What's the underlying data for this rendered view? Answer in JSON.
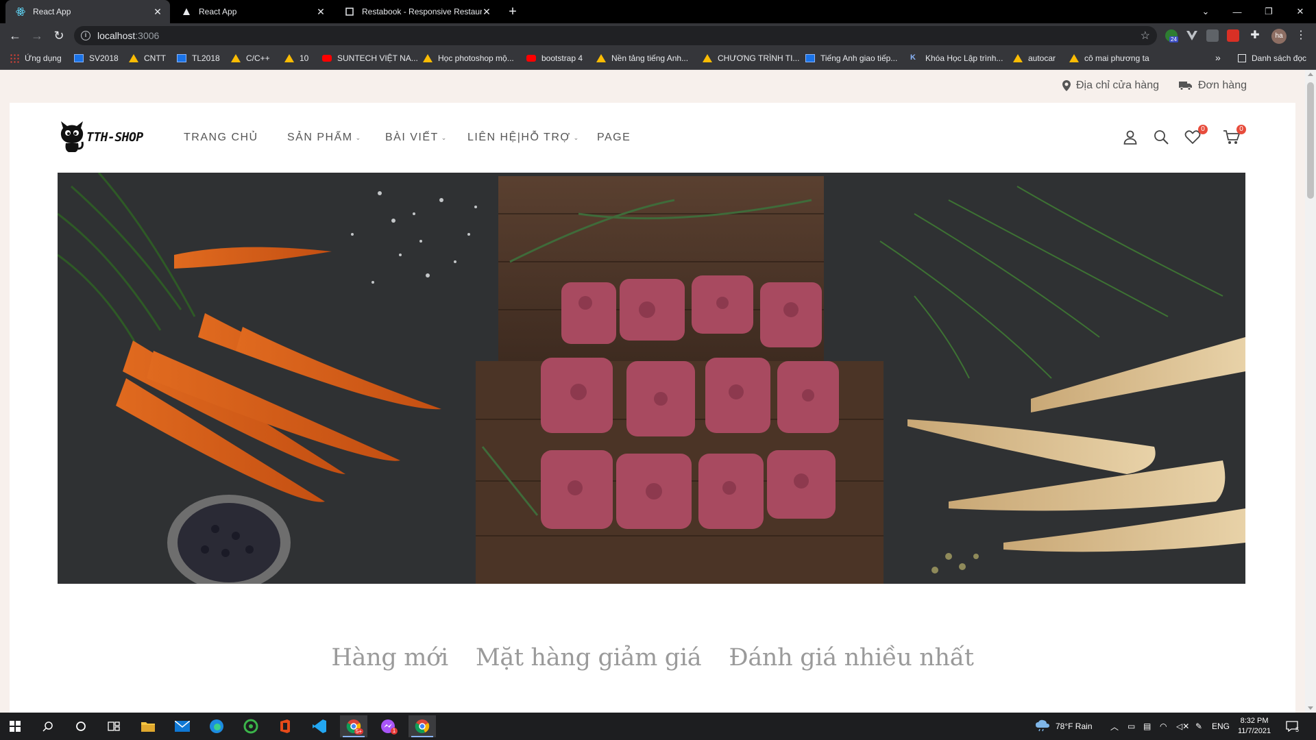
{
  "browser": {
    "tabs": [
      {
        "title": "React App",
        "active": true,
        "icon": "react-icon"
      },
      {
        "title": "React App",
        "active": false,
        "icon": "triangle-icon"
      },
      {
        "title": "Restabook - Responsive Restaura",
        "active": false,
        "icon": "page-icon"
      }
    ],
    "url_host": "localhost",
    "url_port": ":3006",
    "extension_badge": "24",
    "profile_initials": "ha",
    "bookmarks": [
      {
        "label": "Ứng dụng",
        "icon": "apps-grid-icon"
      },
      {
        "label": "SV2018",
        "icon": "monitor-icon"
      },
      {
        "label": "CNTT",
        "icon": "drive-icon"
      },
      {
        "label": "TL2018",
        "icon": "monitor-icon"
      },
      {
        "label": "C/C++",
        "icon": "drive-icon"
      },
      {
        "label": "10",
        "icon": "drive-icon"
      },
      {
        "label": "SUNTECH VIỆT NA...",
        "icon": "youtube-icon"
      },
      {
        "label": "Học photoshop mộ...",
        "icon": "drive-icon"
      },
      {
        "label": "bootstrap 4",
        "icon": "youtube-icon"
      },
      {
        "label": "Nền tảng tiếng Anh...",
        "icon": "drive-icon"
      },
      {
        "label": "CHƯƠNG TRÌNH TI...",
        "icon": "drive-icon"
      },
      {
        "label": "Tiếng Anh giao tiếp...",
        "icon": "site-icon"
      },
      {
        "label": "Khóa Học Lập trình...",
        "icon": "k-icon"
      },
      {
        "label": "autocar",
        "icon": "drive-icon"
      },
      {
        "label": "cô mai phương ta",
        "icon": "drive-icon"
      }
    ],
    "reading_list": "Danh sách đọc",
    "more_bookmarks": "»"
  },
  "page": {
    "top_links": {
      "store_address": "Địa chỉ cửa hàng",
      "orders": "Đơn hàng"
    },
    "logo_text": "TTH-SHOP",
    "menu": [
      {
        "label": "TRANG CHỦ",
        "has_dropdown": false
      },
      {
        "label": "SẢN PHẨM",
        "has_dropdown": true
      },
      {
        "label": "BÀI VIẾT",
        "has_dropdown": true
      },
      {
        "label": "LIÊN HỆ|HỖ TRỢ",
        "has_dropdown": true
      },
      {
        "label": "PAGE",
        "has_dropdown": false
      }
    ],
    "wishlist_count": "0",
    "cart_count": "0",
    "product_tabs": [
      "Hàng mới",
      "Mặt hàng giảm giá",
      "Đánh giá nhiều nhất"
    ],
    "accent_color": "#e74c3c",
    "background_color": "#f7f0ec"
  },
  "taskbar": {
    "weather": "78°F  Rain",
    "language": "ENG",
    "time": "8:32 PM",
    "date": "11/7/2021",
    "notification_count": "5",
    "messenger_badge": "1",
    "app_badge": "5+"
  }
}
